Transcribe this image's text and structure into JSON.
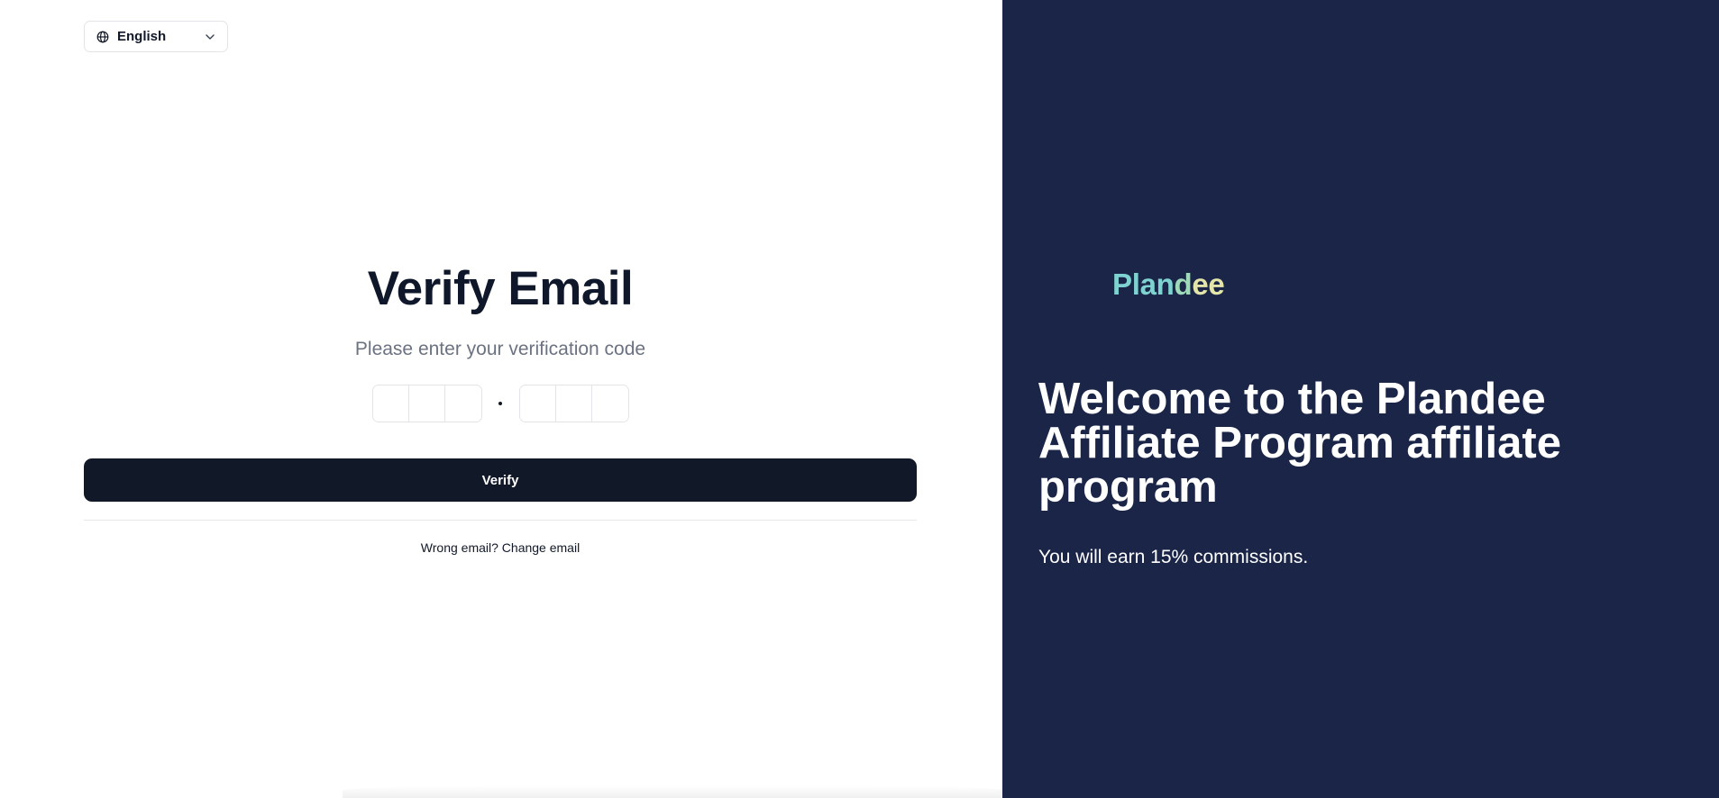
{
  "language_selector": {
    "selected": "English",
    "globe_icon": "globe-icon",
    "chevron_icon": "chevron-down-icon"
  },
  "verify": {
    "title": "Verify Email",
    "subtitle": "Please enter your verification code",
    "otp_slot_count": 6,
    "button_label": "Verify",
    "change_email_text": "Wrong email? Change email"
  },
  "sidebar": {
    "brand_parts": [
      "Plan",
      "d",
      "ee"
    ],
    "welcome_heading": "Welcome to the Plandee Affiliate Program affiliate program",
    "commission_text": "You will earn 15% commissions."
  },
  "colors": {
    "panel_background": "#1a2547",
    "button_background": "#111827",
    "brand_teal": "#7ed3d1",
    "brand_green": "#9ed9b8",
    "brand_yellow": "#e4e6a9"
  }
}
